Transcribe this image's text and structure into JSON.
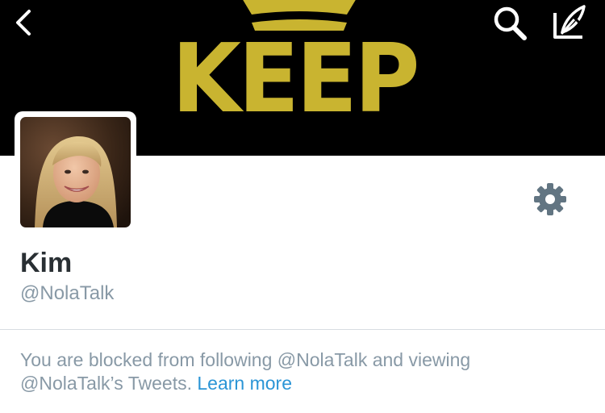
{
  "header": {
    "banner_text": "KEEP",
    "icons": [
      "back-chevron-icon",
      "search-icon",
      "compose-tweet-icon"
    ]
  },
  "profile": {
    "name": "Kim",
    "handle": "@NolaTalk"
  },
  "settings": {
    "icon": "gear-icon",
    "color": "#627582"
  },
  "notice": {
    "blocked_line1": "You are blocked from following @NolaTalk and viewing",
    "blocked_line2": "@NolaTalk’s Tweets.",
    "learn_more": "Learn more"
  },
  "colors": {
    "banner_text": "#c9b430",
    "link": "#2b95d6",
    "muted": "#8899a6",
    "name": "#292f33"
  }
}
